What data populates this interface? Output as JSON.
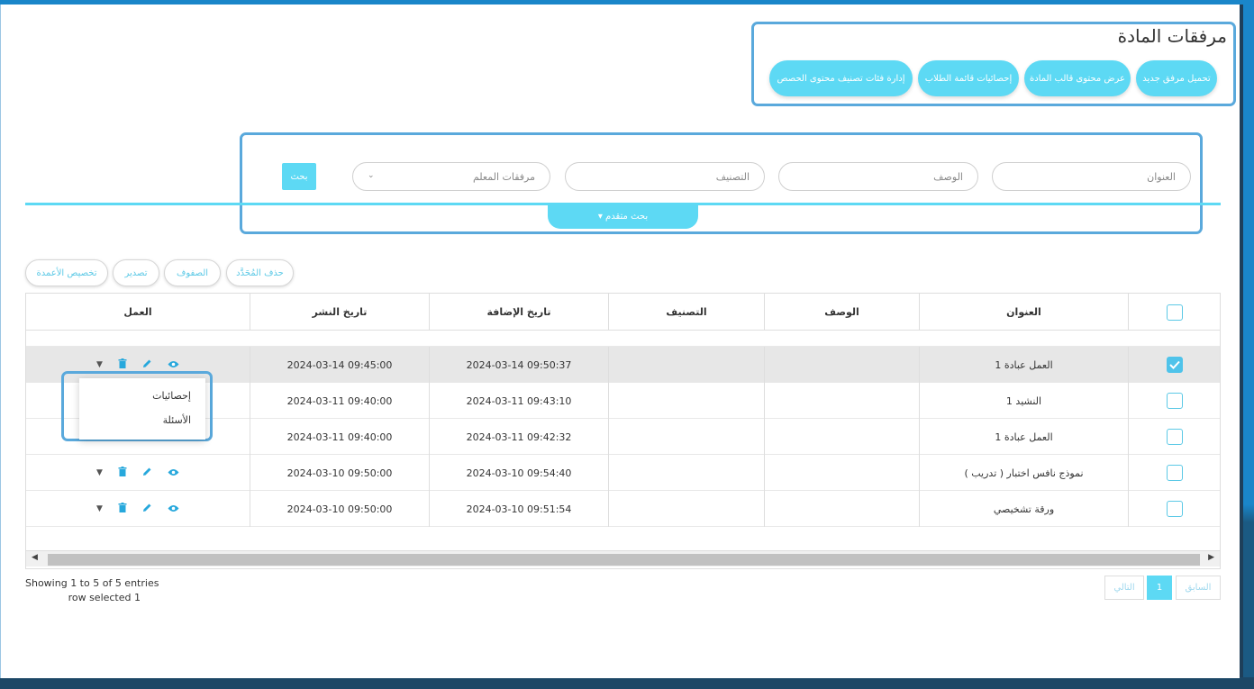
{
  "page": {
    "title": "مرفقات المادة",
    "actions": [
      "تحميل مرفق جديد",
      "عرض محتوى قالب المادة",
      "إحصائيات قائمة الطلاب",
      "إدارة فئات تصنيف محتوى الحصص"
    ]
  },
  "search": {
    "title_placeholder": "العنوان",
    "description_placeholder": "الوصف",
    "category_placeholder": "التصنيف",
    "attachments_select": "مرفقات المعلم",
    "search_button": "بحث",
    "advanced_search": "بحث متقدم ▾"
  },
  "toolbar": {
    "delete_selected": "حذف المُحَدَّد",
    "rows": "الصفوف",
    "export": "تصدير",
    "customize_columns": "تخصيص الأعمدة"
  },
  "table": {
    "headers": {
      "title": "العنوان",
      "description": "الوصف",
      "category": "التصنيف",
      "added_date": "تاريخ الإضافة",
      "publish_date": "تاريخ النشر",
      "action": "العمل"
    },
    "rows": [
      {
        "checked": true,
        "title": "العمل عبادة 1",
        "description": "",
        "category": "",
        "added": "2024-03-14 09:50:37",
        "published": "2024-03-14 09:45:00"
      },
      {
        "checked": false,
        "title": "النشيد 1",
        "description": "",
        "category": "",
        "added": "2024-03-11 09:43:10",
        "published": "2024-03-11 09:40:00"
      },
      {
        "checked": false,
        "title": "العمل عبادة 1",
        "description": "",
        "category": "",
        "added": "2024-03-11 09:42:32",
        "published": "2024-03-11 09:40:00"
      },
      {
        "checked": false,
        "title": "نموذج نافس اختبار ( تدريب )",
        "description": "",
        "category": "",
        "added": "2024-03-10 09:54:40",
        "published": "2024-03-10 09:50:00"
      },
      {
        "checked": false,
        "title": "ورقة تشخيصي",
        "description": "",
        "category": "",
        "added": "2024-03-10 09:51:54",
        "published": "2024-03-10 09:50:00"
      }
    ]
  },
  "dropdown": {
    "items": [
      "إحصائيات",
      "الأسئلة"
    ]
  },
  "footer": {
    "entries_info": "Showing 1 to 5 of 5 entries",
    "selected_info": "row selected 1",
    "prev": "السابق",
    "page": "1",
    "next": "التالي"
  },
  "colors": {
    "accent": "#5dd9f4",
    "highlight_border": "#5aa9dc",
    "icon": "#27a8dc"
  },
  "icons": {
    "view": "eye-icon",
    "edit": "pencil-icon",
    "delete": "trash-icon",
    "more": "caret-down-icon"
  }
}
